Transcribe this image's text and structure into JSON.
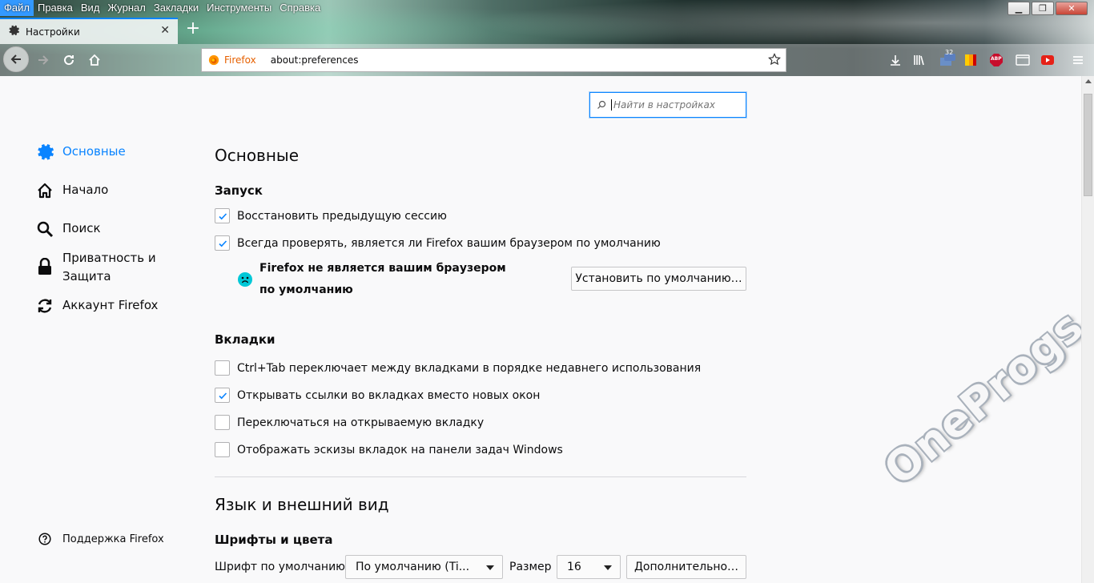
{
  "menubar": {
    "items": [
      "Файл",
      "Правка",
      "Вид",
      "Журнал",
      "Закладки",
      "Инструменты",
      "Справка"
    ]
  },
  "window": {
    "minimize": "▁",
    "restore": "❐",
    "close": "✕"
  },
  "tab": {
    "title": "Настройки",
    "close": "✕",
    "new_tab": "+"
  },
  "urlbar": {
    "brand": "Firefox",
    "url": "about:preferences"
  },
  "toolbar": {
    "badge_count": "32",
    "abp_label": "ABP"
  },
  "search": {
    "placeholder": "Найти в настройках"
  },
  "sidebar": {
    "items": [
      {
        "label": "Основные",
        "icon": "gear-icon",
        "selected": true
      },
      {
        "label": "Начало",
        "icon": "home-icon"
      },
      {
        "label": "Поиск",
        "icon": "search-icon"
      },
      {
        "label": "Приватность и Защита",
        "icon": "lock-icon"
      },
      {
        "label": "Аккаунт Firefox",
        "icon": "sync-icon"
      }
    ],
    "support": "Поддержка Firefox"
  },
  "main": {
    "title": "Основные",
    "startup": {
      "heading": "Запуск",
      "restore_session": "Восстановить предыдущую сессию",
      "check_default": "Всегда проверять, является ли Firefox вашим браузером по умолчанию",
      "not_default_msg": "Firefox не является вашим браузером по умолчанию",
      "set_default_button": "Установить по умолчанию…"
    },
    "tabs": {
      "heading": "Вкладки",
      "items": [
        {
          "label": "Ctrl+Tab переключает между вкладками в порядке недавнего использования",
          "checked": false
        },
        {
          "label": "Открывать ссылки во вкладках вместо новых окон",
          "checked": true
        },
        {
          "label": "Переключаться на открываемую вкладку",
          "checked": false
        },
        {
          "label": "Отображать эскизы вкладок на панели задач Windows",
          "checked": false
        }
      ]
    },
    "language": {
      "heading": "Язык и внешний вид",
      "fonts_heading": "Шрифты и цвета",
      "default_font_label": "Шрифт по умолчанию",
      "default_font_value": "По умолчанию (Ti...",
      "size_label": "Размер",
      "size_value": "16",
      "advanced_button": "Дополнительно…"
    }
  },
  "watermark": "OneProgs.ru",
  "colors": {
    "accent": "#0a84ff",
    "firefox_orange": "#e66000"
  }
}
